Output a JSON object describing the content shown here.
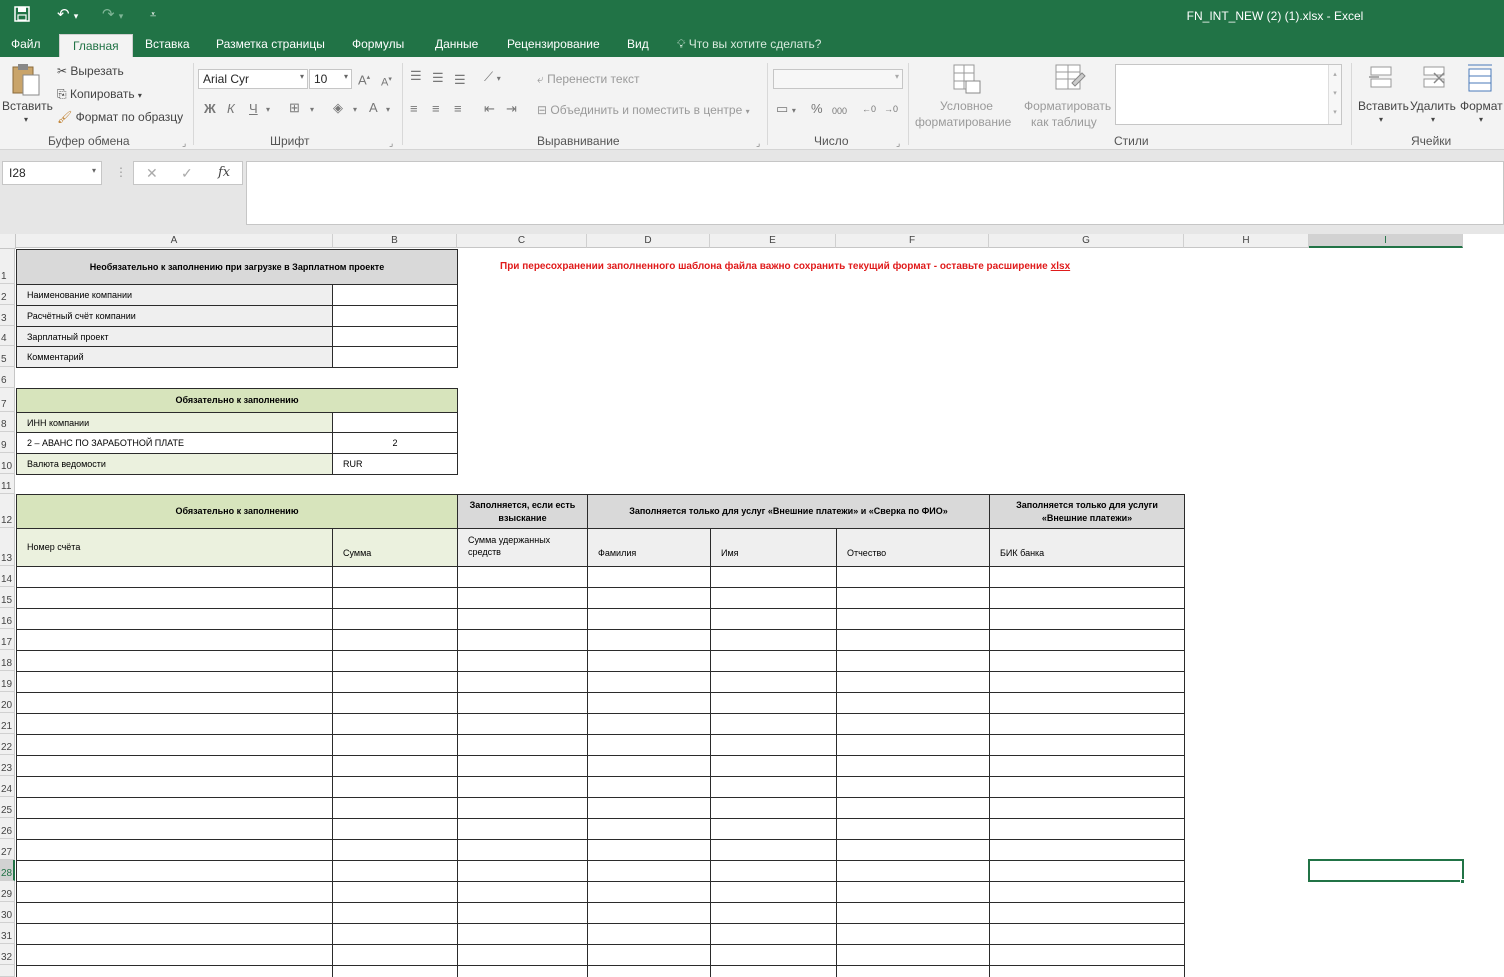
{
  "qat": {
    "save_icon": "save-icon",
    "undo_icon": "undo-icon",
    "redo_icon": "redo-icon",
    "customize_icon": "customize-qat-icon"
  },
  "title": "FN_INT_NEW (2) (1).xlsx  -  Excel",
  "tabs": [
    "Файл",
    "Главная",
    "Вставка",
    "Разметка страницы",
    "Формулы",
    "Данные",
    "Рецензирование",
    "Вид"
  ],
  "tell_me": "Что вы хотите сделать?",
  "ribbon": {
    "clipboard": {
      "paste": "Вставить",
      "cut": "Вырезать",
      "copy": "Копировать",
      "format_painter": "Формат по образцу",
      "group": "Буфер обмена"
    },
    "font": {
      "name": "Arial Cyr",
      "size": "10",
      "group": "Шрифт",
      "bold": "Ж",
      "italic": "К",
      "underline": "Ч"
    },
    "alignment": {
      "wrap": "Перенести текст",
      "merge": "Объединить и поместить в центре",
      "group": "Выравнивание"
    },
    "number": {
      "group": "Число",
      "percent": "%",
      "thousands": "000"
    },
    "styles": {
      "conditional_1": "Условное",
      "conditional_2": "форматирование",
      "table_1": "Форматировать",
      "table_2": "как таблицу",
      "group": "Стили"
    },
    "cells": {
      "insert": "Вставить",
      "delete": "Удалить",
      "format": "Формат",
      "group": "Ячейки"
    }
  },
  "formula_bar": {
    "name_box": "I28",
    "fx": "fx",
    "value": ""
  },
  "columns": [
    "A",
    "B",
    "C",
    "D",
    "E",
    "F",
    "G",
    "H",
    "I"
  ],
  "rows": [
    "1",
    "2",
    "3",
    "4",
    "5",
    "6",
    "7",
    "8",
    "9",
    "10",
    "11",
    "12",
    "13",
    "14",
    "15",
    "16",
    "17",
    "18",
    "19",
    "20",
    "21",
    "22",
    "23",
    "24",
    "25",
    "26",
    "27",
    "28",
    "29",
    "30",
    "31",
    "32"
  ],
  "cells": {
    "a1": "Необязательно к заполнению при загрузке в Зарплатном проекте",
    "notice": "При пересохранении заполненного шаблона файла важно сохранить текущий формат - оставьте расширение ",
    "notice_ext": "xlsx",
    "a2": "Наименование компании",
    "a3": "Расчётный счёт компании",
    "a4": "Зарплатный проект",
    "a5": "Комментарий",
    "a7": "Обязательно к заполнению",
    "a8": "ИНН компании",
    "a9": "2 – АВАНС ПО ЗАРАБОТНОЙ ПЛАТЕ",
    "b9": "2",
    "a10": "Валюта ведомости",
    "b10": "RUR",
    "a12": "Обязательно к заполнению",
    "c12": "Заполняется, если есть взыскание",
    "d12": "Заполняется только для услуг «Внешние платежи» и «Сверка по ФИО»",
    "g12": "Заполняется только для услуги «Внешние платежи»",
    "a13": "Номер счёта",
    "b13": "Сумма",
    "c13": "Сумма удержанных средств",
    "d13": "Фамилия",
    "e13": "Имя",
    "f13": "Отчество",
    "g13": "БИК банка"
  },
  "colors": {
    "excel_green": "#217346",
    "notice_red": "#e01b1b",
    "header_gray": "#d9d9d9",
    "label_gray": "#efefef",
    "required_green": "#d7e4bc"
  }
}
